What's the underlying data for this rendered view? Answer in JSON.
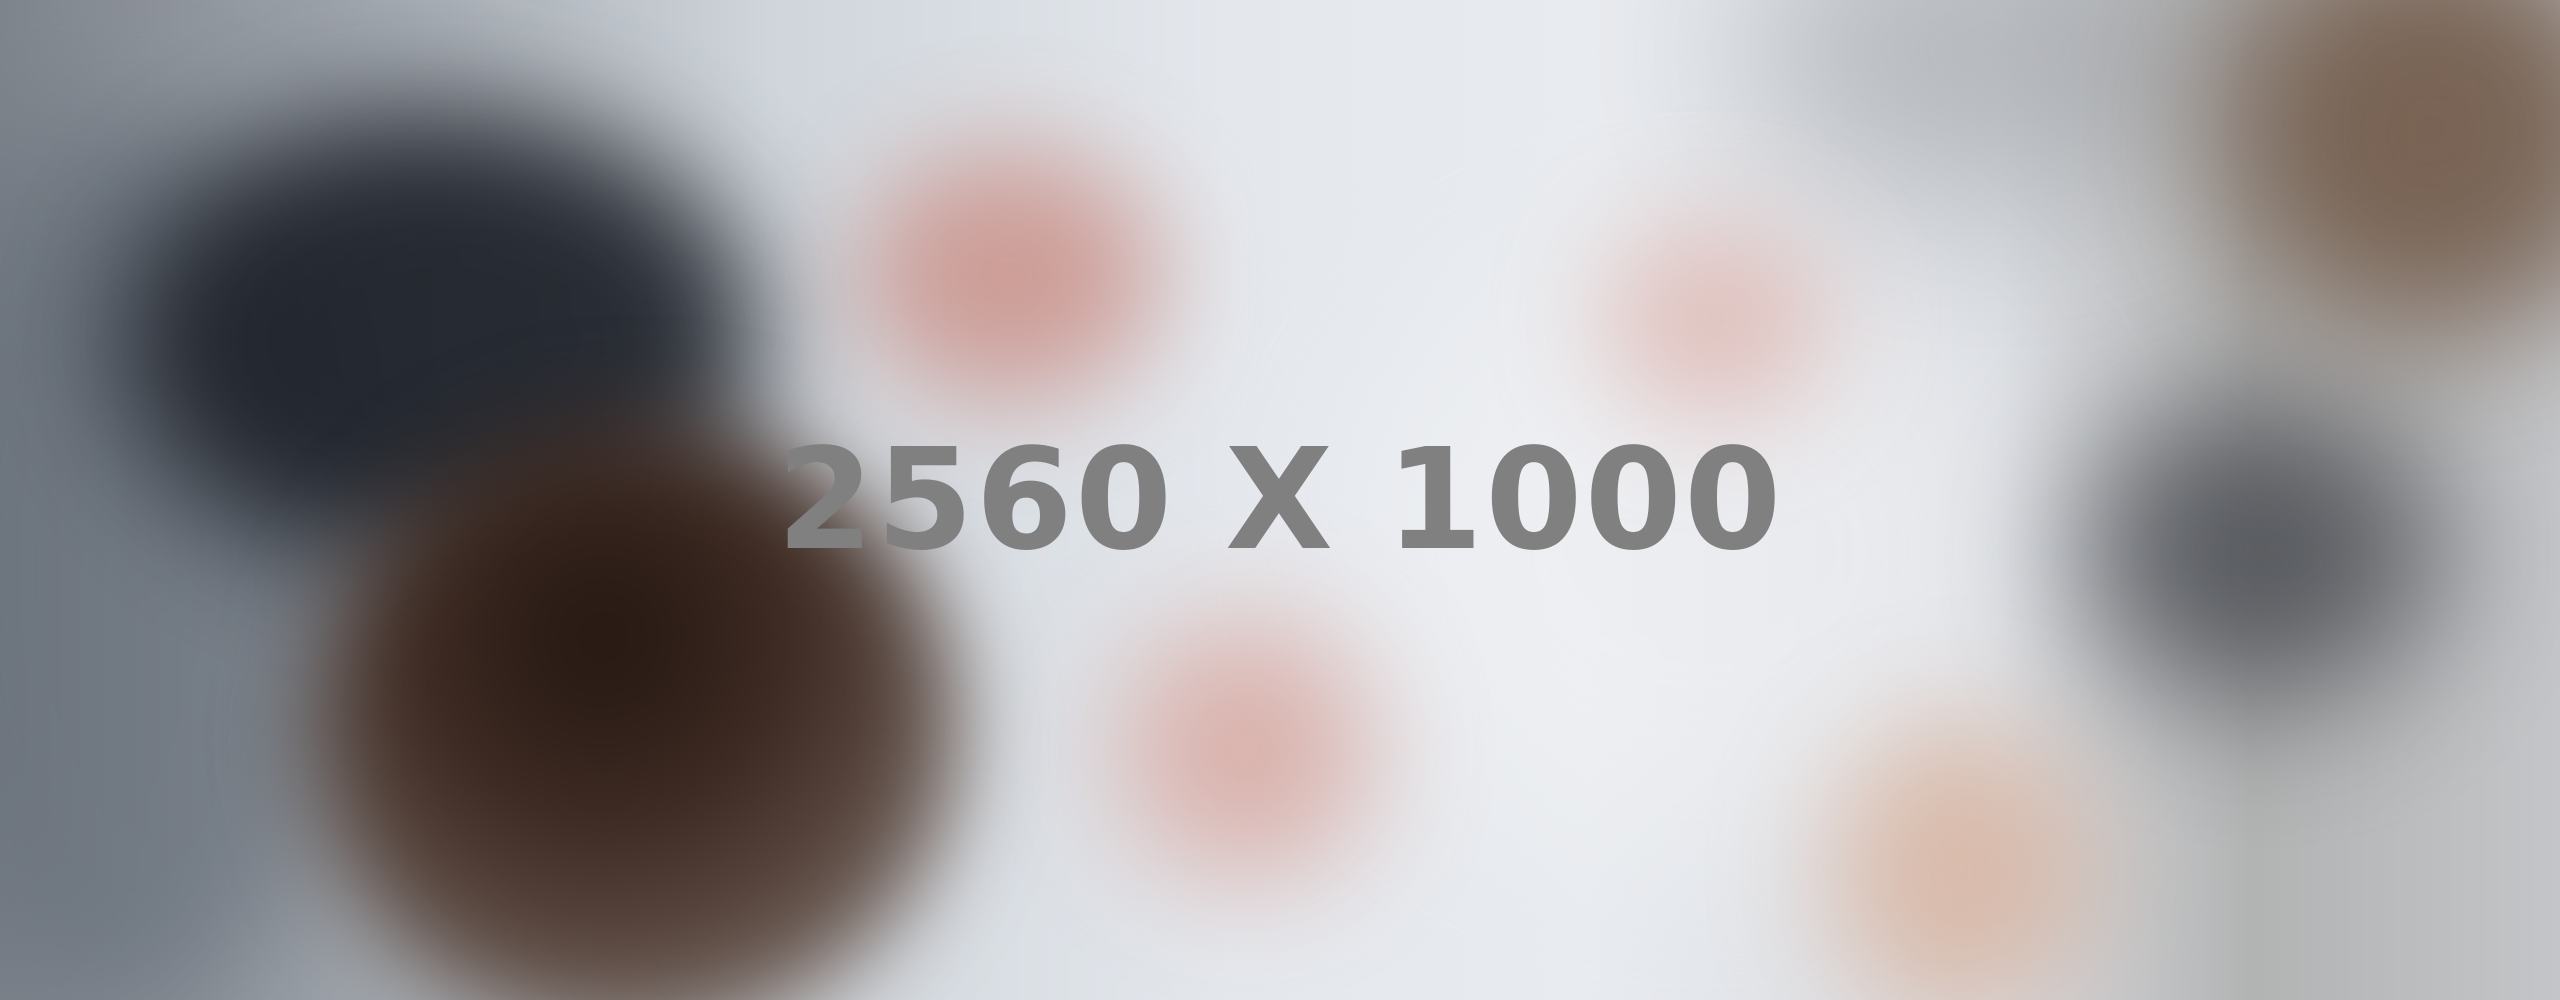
{
  "placeholder": {
    "label": "2560 X 1000"
  },
  "colors": {
    "label_text": "#808080"
  }
}
